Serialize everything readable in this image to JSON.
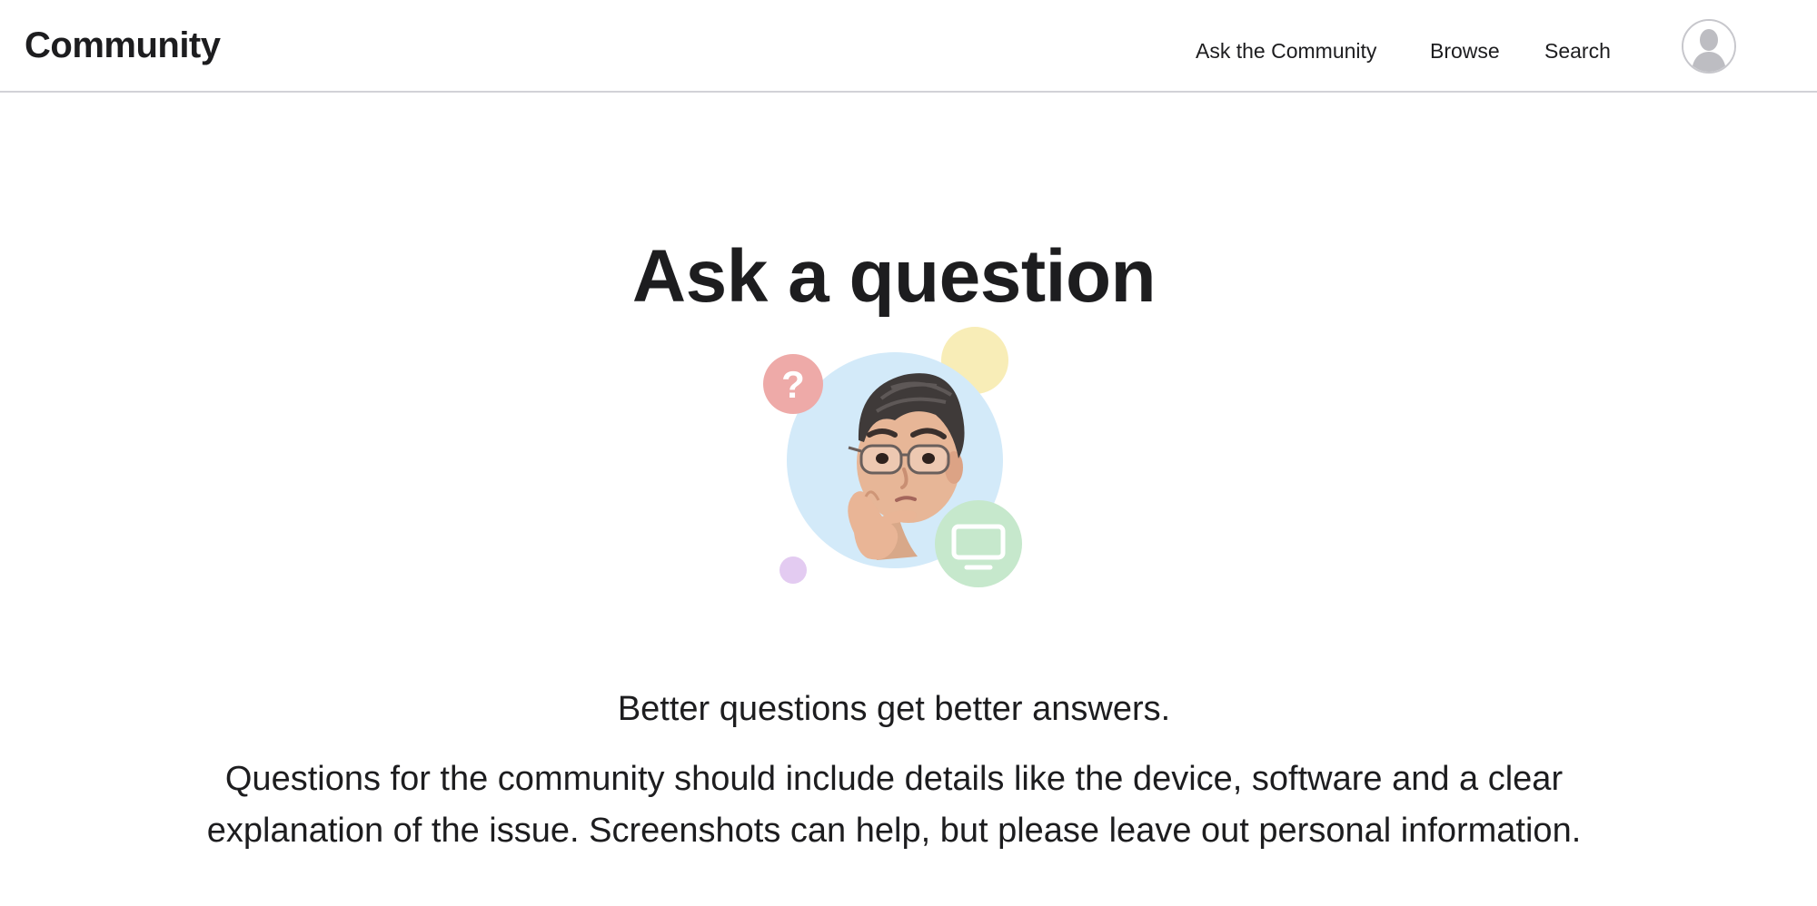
{
  "header": {
    "brand": "Community",
    "nav": {
      "ask": "Ask the Community",
      "browse": "Browse",
      "search": "Search"
    },
    "avatar_icon": "user-silhouette-icon"
  },
  "main": {
    "title": "Ask a question",
    "illustration": {
      "icons": [
        "memoji-thinking-avatar",
        "question-mark-icon",
        "monitor-icon"
      ],
      "question_glyph": "?"
    },
    "subtitle": "Better questions get better answers.",
    "description": "Questions for the community should include details like the device, software and a clear explanation of the issue. Screenshots can help, but please leave out personal information."
  },
  "colors": {
    "text": "#1d1d1f",
    "divider": "#d2d2d7",
    "bubble_blue": "#d3eaf9",
    "bubble_red": "#eeaaa8",
    "bubble_yellow": "#f8edb7",
    "bubble_green": "#c6e8cc",
    "bubble_purple": "#e3cbf1"
  }
}
